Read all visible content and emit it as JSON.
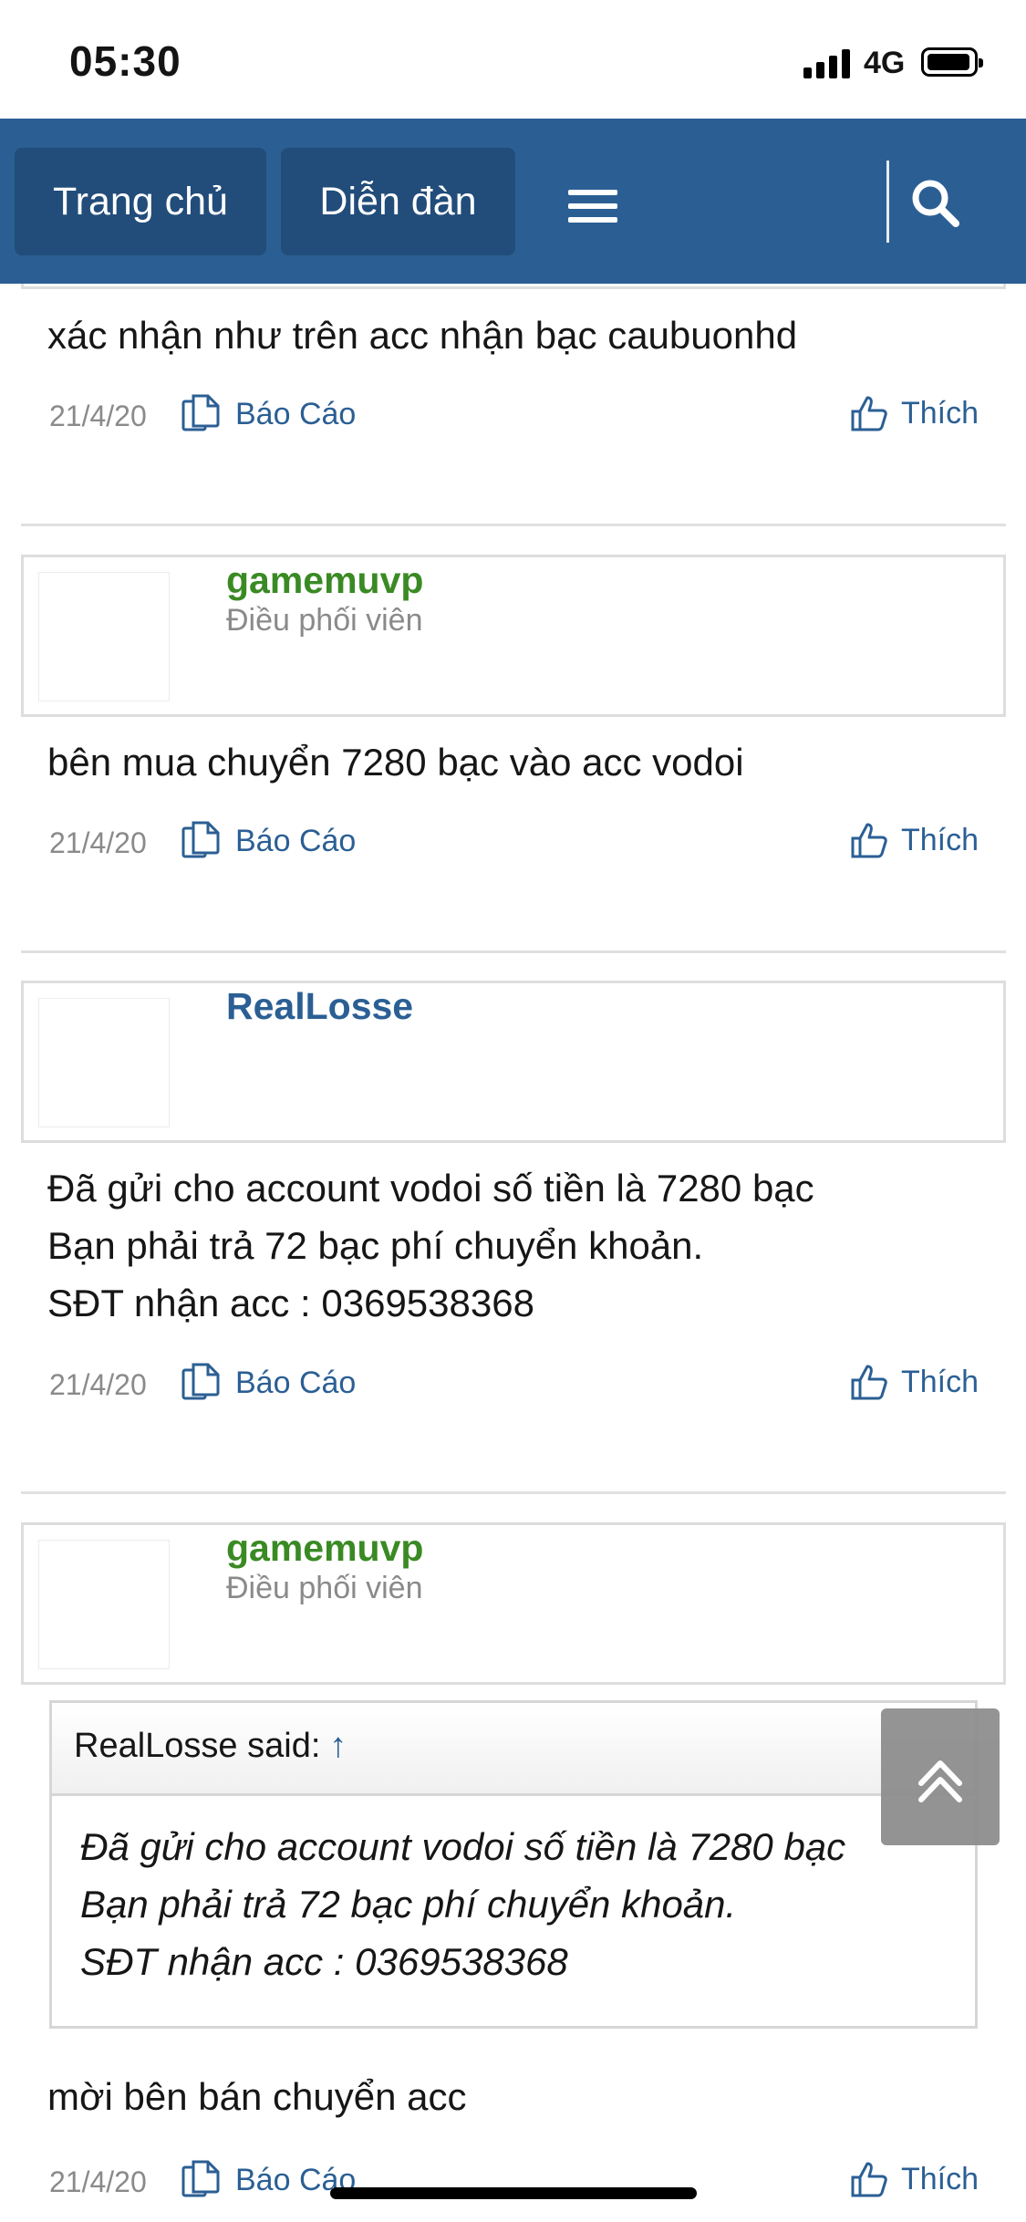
{
  "status_bar": {
    "time": "05:30",
    "network": "4G"
  },
  "navbar": {
    "home_label": "Trang chủ",
    "forum_label": "Diễn đàn"
  },
  "posts": [
    {
      "text": "xác nhận như trên acc nhận bạc caubuonhd",
      "date": "21/4/20",
      "report_label": "Báo Cáo",
      "like_label": "Thích"
    },
    {
      "username": "gamemuvp",
      "role": "Điều phối viên",
      "text": "bên mua chuyển 7280 bạc vào acc vodoi",
      "date": "21/4/20",
      "report_label": "Báo Cáo",
      "like_label": "Thích"
    },
    {
      "username": "RealLosse",
      "text": "Đã gửi cho account vodoi số tiền là 7280 bạc\nBạn phải trả 72 bạc phí chuyển khoản.\nSĐT nhận acc : 0369538368",
      "date": "21/4/20",
      "report_label": "Báo Cáo",
      "like_label": "Thích"
    },
    {
      "username": "gamemuvp",
      "role": "Điều phối viên",
      "quote": {
        "author_label": "RealLosse said:",
        "arrow": "↑",
        "text": "Đã gửi cho account vodoi số tiền là 7280 bạc\nBạn phải trả 72 bạc phí chuyển khoản.\nSĐT nhận acc : 0369538368"
      },
      "text": "mời bên bán chuyển acc",
      "date": "21/4/20",
      "report_label": "Báo Cáo",
      "like_label": "Thích"
    }
  ],
  "colors": {
    "nav_bg": "#2b5f94",
    "nav_button": "#224d7a",
    "link": "#2b5f94",
    "moderator": "#3a8a24"
  }
}
